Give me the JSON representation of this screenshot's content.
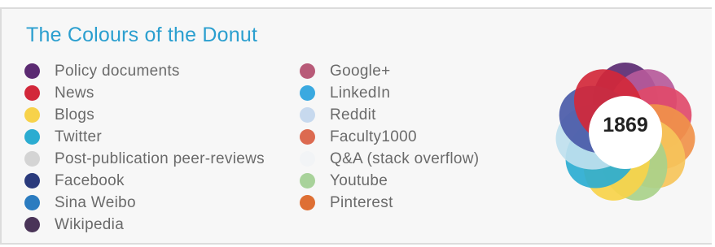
{
  "title": "The Colours of the Donut",
  "legend_left": [
    {
      "label": "Policy documents",
      "color": "#5b2a72"
    },
    {
      "label": "News",
      "color": "#d2283a"
    },
    {
      "label": "Blogs",
      "color": "#f7d24a"
    },
    {
      "label": "Twitter",
      "color": "#2bacd1"
    },
    {
      "label": "Post-publication peer-reviews",
      "color": "#d4d4d4"
    },
    {
      "label": "Facebook",
      "color": "#2a3a7c"
    },
    {
      "label": "Sina Weibo",
      "color": "#2b7cc0"
    },
    {
      "label": "Wikipedia",
      "color": "#4a3458"
    }
  ],
  "legend_right": [
    {
      "label": "Google+",
      "color": "#b85a78"
    },
    {
      "label": "LinkedIn",
      "color": "#3aa9e0"
    },
    {
      "label": "Reddit",
      "color": "#c7d9ee"
    },
    {
      "label": "Faculty1000",
      "color": "#dc6a50"
    },
    {
      "label": "Q&A (stack overflow)",
      "color": "#f2f4f6"
    },
    {
      "label": "Youtube",
      "color": "#a8d29a"
    },
    {
      "label": "Pinterest",
      "color": "#de6f34"
    }
  ],
  "score": "1869",
  "donut_colors": [
    "#5b2a72",
    "#b65a9a",
    "#e04a6a",
    "#f0914a",
    "#f6c45a",
    "#a9d18a",
    "#f7d24a",
    "#2bacd1",
    "#bfe0ee",
    "#4a5aa8",
    "#d2283a"
  ]
}
